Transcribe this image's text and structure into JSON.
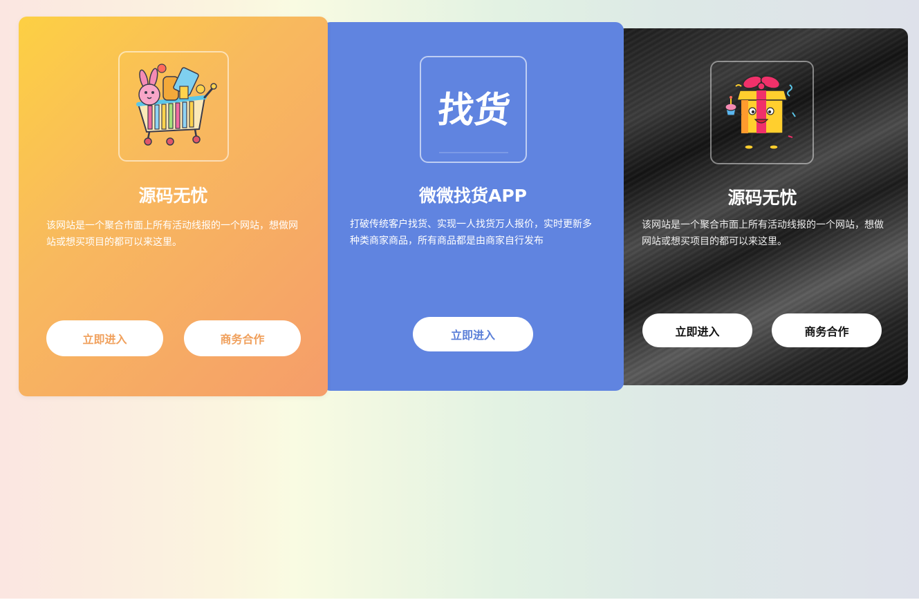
{
  "cards": [
    {
      "title": "源码无忧",
      "description": "该网站是一个聚合市面上所有活动线报的一个网站，想做网站或想买项目的都可以来这里。",
      "buttons": {
        "enter": "立即进入",
        "business": "商务合作"
      },
      "logo_icon": "shopping-cart-bunny-icon",
      "accent_color": "#f0a05c"
    },
    {
      "title": "微微找货APP",
      "description": "打破传统客户找货、实现一人找货万人报价，实时更新多种类商家商品，所有商品都是由商家自行发布",
      "buttons": {
        "enter": "立即进入"
      },
      "logo_text": "找货",
      "logo_icon": "zhaohuo-logo-icon",
      "accent_color": "#6084e0"
    },
    {
      "title": "源码无忧",
      "description": "该网站是一个聚合市面上所有活动线报的一个网站，想做网站或想买项目的都可以来这里。",
      "buttons": {
        "enter": "立即进入",
        "business": "商务合作"
      },
      "logo_icon": "gift-box-character-icon",
      "accent_color": "#111111"
    }
  ]
}
